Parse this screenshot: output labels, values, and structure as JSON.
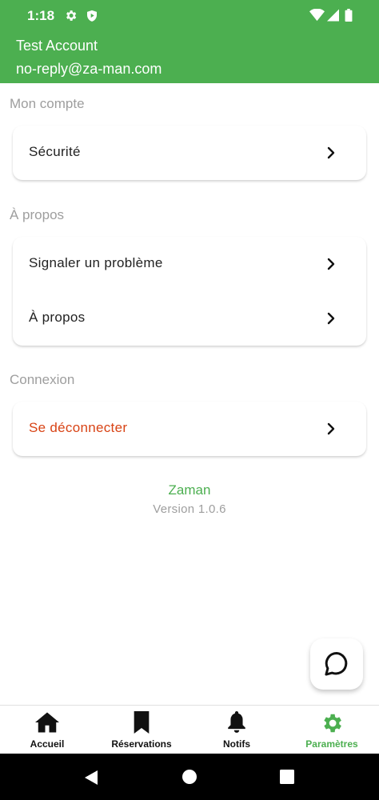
{
  "status_bar": {
    "time": "1:18"
  },
  "header": {
    "name": "Test Account",
    "email": "no-reply@za-man.com"
  },
  "sections": {
    "account": {
      "title": "Mon compte",
      "security_label": "Sécurité"
    },
    "about": {
      "title": "À propos",
      "report_label": "Signaler un problème",
      "about_label": "À propos"
    },
    "connection": {
      "title": "Connexion",
      "logout_label": "Se déconnecter"
    }
  },
  "app_info": {
    "name": "Zaman",
    "version": "Version 1.0.6"
  },
  "bottom_nav": {
    "home": "Accueil",
    "reservations": "Réservations",
    "notifs": "Notifs",
    "settings": "Paramètres",
    "active": "settings"
  },
  "colors": {
    "primary": "#4caf50",
    "danger": "#d84315",
    "muted": "#9e9e9e"
  }
}
